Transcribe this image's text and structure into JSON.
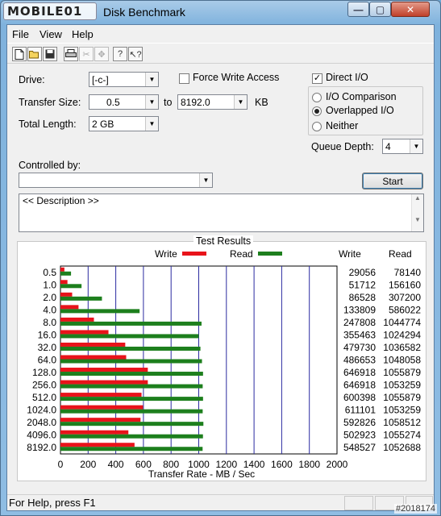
{
  "window": {
    "title": "Disk Benchmark",
    "logo_text": "MOBILE01",
    "controls": {
      "minimize": "—",
      "maximize": "▢",
      "close": "✕"
    }
  },
  "menu": [
    "File",
    "View",
    "Help"
  ],
  "toolbar": {
    "icons": [
      "new-icon",
      "open-icon",
      "save-icon",
      "print-icon",
      "cut-icon",
      "move-icon",
      "help-icon",
      "context-help-icon"
    ]
  },
  "form": {
    "drive": {
      "label": "Drive:",
      "value": "[-c-]"
    },
    "force_write": {
      "label": "Force Write Access",
      "checked": false
    },
    "direct_io": {
      "label": "Direct I/O",
      "checked": true
    },
    "transfer_size": {
      "label": "Transfer Size:",
      "from": "0.5",
      "to_label": "to",
      "to": "8192.0",
      "unit": "KB"
    },
    "total_length": {
      "label": "Total Length:",
      "value": "2 GB"
    },
    "io_mode": {
      "options": [
        "I/O Comparison",
        "Overlapped I/O",
        "Neither"
      ],
      "selected": "Overlapped I/O"
    },
    "queue_depth": {
      "label": "Queue Depth:",
      "value": "4"
    },
    "controlled_by": {
      "label": "Controlled by:",
      "value": ""
    },
    "start_button": "Start",
    "description": "<< Description >>"
  },
  "results": {
    "title": "Test Results",
    "legend_write": "Write",
    "legend_read": "Read",
    "col_write": "Write",
    "col_read": "Read",
    "write_color": "#e8131a",
    "read_color": "#1d7f1d"
  },
  "chart_data": {
    "type": "bar",
    "orientation": "horizontal",
    "xlabel": "Transfer Rate - MB / Sec",
    "xlim": [
      0,
      2000
    ],
    "xticks": [
      0,
      200,
      400,
      600,
      800,
      1000,
      1200,
      1400,
      1600,
      1800,
      2000
    ],
    "categories": [
      "0.5",
      "1.0",
      "2.0",
      "4.0",
      "8.0",
      "16.0",
      "32.0",
      "64.0",
      "128.0",
      "256.0",
      "512.0",
      "1024.0",
      "2048.0",
      "4096.0",
      "8192.0"
    ],
    "series": [
      {
        "name": "Write",
        "values": [
          29056,
          51712,
          86528,
          133809,
          247808,
          355463,
          479730,
          486653,
          646918,
          646918,
          600398,
          611101,
          592826,
          502923,
          548527
        ]
      },
      {
        "name": "Read",
        "values": [
          78140,
          156160,
          307200,
          586022,
          1044774,
          1024294,
          1036582,
          1048058,
          1055879,
          1053259,
          1055879,
          1053259,
          1058512,
          1055274,
          1052688
        ]
      }
    ]
  },
  "status": {
    "text": "For Help, press F1"
  },
  "watermark": "#2018174"
}
